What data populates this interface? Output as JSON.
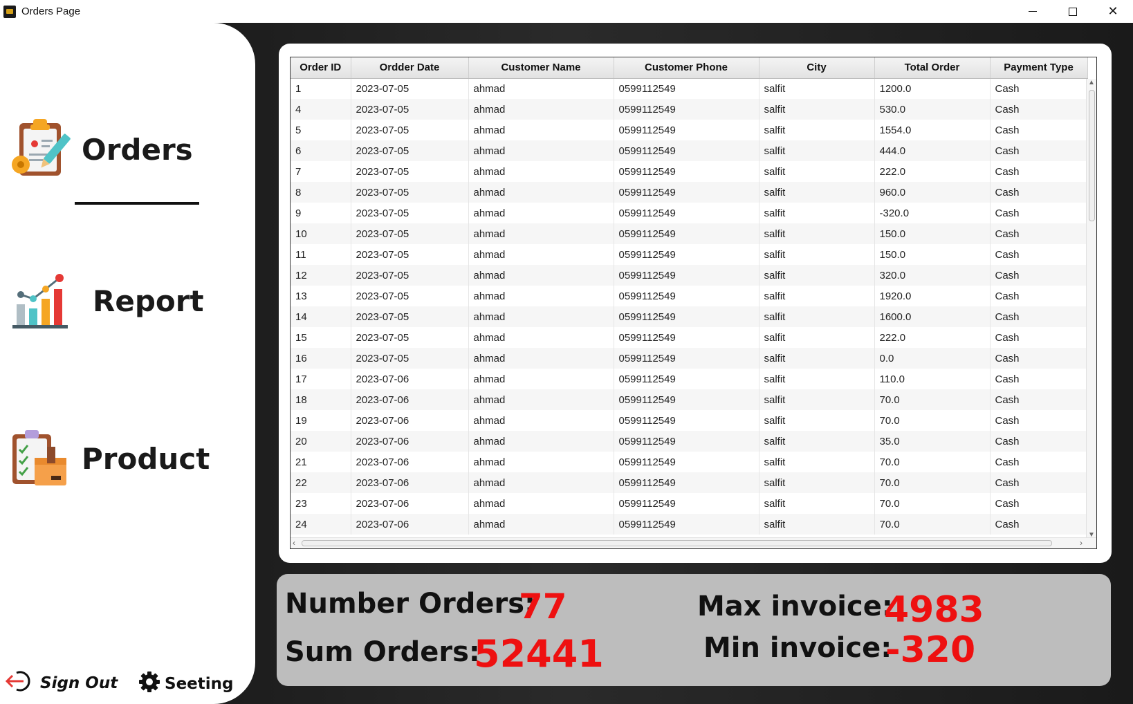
{
  "window": {
    "title": "Orders Page",
    "controls": {
      "minimize": "—",
      "maximize": "☐",
      "close": "✕"
    }
  },
  "sidebar": {
    "items": [
      {
        "label": "Orders",
        "icon": "clipboard-edit-icon",
        "active": true
      },
      {
        "label": "Report",
        "icon": "bar-chart-icon",
        "active": false
      },
      {
        "label": "Product",
        "icon": "product-checklist-icon",
        "active": false
      }
    ],
    "sign_out": "Sign Out",
    "settings": "Seeting"
  },
  "table": {
    "columns": [
      "Order ID",
      "Ordder Date",
      "Customer Name",
      "Customer Phone",
      "City",
      "Total Order",
      "Payment Type"
    ],
    "rows": [
      [
        "1",
        "2023-07-05",
        "ahmad",
        "0599112549",
        "salfit",
        "1200.0",
        "Cash"
      ],
      [
        "4",
        "2023-07-05",
        "ahmad",
        "0599112549",
        "salfit",
        "530.0",
        "Cash"
      ],
      [
        "5",
        "2023-07-05",
        "ahmad",
        "0599112549",
        "salfit",
        "1554.0",
        "Cash"
      ],
      [
        "6",
        "2023-07-05",
        "ahmad",
        "0599112549",
        "salfit",
        "444.0",
        "Cash"
      ],
      [
        "7",
        "2023-07-05",
        "ahmad",
        "0599112549",
        "salfit",
        "222.0",
        "Cash"
      ],
      [
        "8",
        "2023-07-05",
        "ahmad",
        "0599112549",
        "salfit",
        "960.0",
        "Cash"
      ],
      [
        "9",
        "2023-07-05",
        "ahmad",
        "0599112549",
        "salfit",
        "-320.0",
        "Cash"
      ],
      [
        "10",
        "2023-07-05",
        "ahmad",
        "0599112549",
        "salfit",
        "150.0",
        "Cash"
      ],
      [
        "11",
        "2023-07-05",
        "ahmad",
        "0599112549",
        "salfit",
        "150.0",
        "Cash"
      ],
      [
        "12",
        "2023-07-05",
        "ahmad",
        "0599112549",
        "salfit",
        "320.0",
        "Cash"
      ],
      [
        "13",
        "2023-07-05",
        "ahmad",
        "0599112549",
        "salfit",
        "1920.0",
        "Cash"
      ],
      [
        "14",
        "2023-07-05",
        "ahmad",
        "0599112549",
        "salfit",
        "1600.0",
        "Cash"
      ],
      [
        "15",
        "2023-07-05",
        "ahmad",
        "0599112549",
        "salfit",
        "222.0",
        "Cash"
      ],
      [
        "16",
        "2023-07-05",
        "ahmad",
        "0599112549",
        "salfit",
        "0.0",
        "Cash"
      ],
      [
        "17",
        "2023-07-06",
        "ahmad",
        "0599112549",
        "salfit",
        "110.0",
        "Cash"
      ],
      [
        "18",
        "2023-07-06",
        "ahmad",
        "0599112549",
        "salfit",
        "70.0",
        "Cash"
      ],
      [
        "19",
        "2023-07-06",
        "ahmad",
        "0599112549",
        "salfit",
        "70.0",
        "Cash"
      ],
      [
        "20",
        "2023-07-06",
        "ahmad",
        "0599112549",
        "salfit",
        "35.0",
        "Cash"
      ],
      [
        "21",
        "2023-07-06",
        "ahmad",
        "0599112549",
        "salfit",
        "70.0",
        "Cash"
      ],
      [
        "22",
        "2023-07-06",
        "ahmad",
        "0599112549",
        "salfit",
        "70.0",
        "Cash"
      ],
      [
        "23",
        "2023-07-06",
        "ahmad",
        "0599112549",
        "salfit",
        "70.0",
        "Cash"
      ],
      [
        "24",
        "2023-07-06",
        "ahmad",
        "0599112549",
        "salfit",
        "70.0",
        "Cash"
      ]
    ]
  },
  "stats": {
    "number_orders_label": "Number Orders:",
    "number_orders_value": "77",
    "sum_orders_label": "Sum Orders:",
    "sum_orders_value": "52441",
    "max_invoice_label": "Max invoice:",
    "max_invoice_value": "4983",
    "min_invoice_label": "Min invoice:",
    "min_invoice_value": "-320"
  },
  "colors": {
    "accent_value": "#ee1010",
    "stats_bg": "#bdbdbd",
    "sidebar_bg": "#ffffff"
  }
}
